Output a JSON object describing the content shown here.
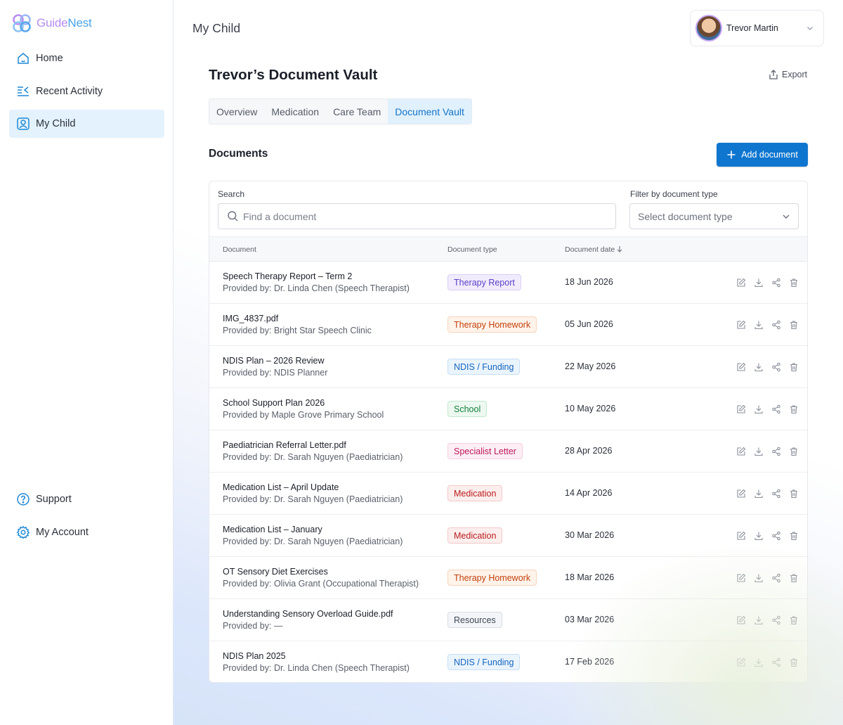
{
  "brand": {
    "name_part1": "Guide",
    "name_part2": "Nest"
  },
  "sidebar": {
    "top_items": [
      {
        "label": "Home",
        "icon": "home-icon",
        "active": false
      },
      {
        "label": "Recent Activity",
        "icon": "activity-icon",
        "active": false
      },
      {
        "label": "My Child",
        "icon": "child-profile-icon",
        "active": true
      }
    ],
    "bottom_items": [
      {
        "label": "Support",
        "icon": "help-icon"
      },
      {
        "label": "My Account",
        "icon": "gear-icon"
      }
    ]
  },
  "header": {
    "title": "My Child",
    "user_name": "Trevor Martin"
  },
  "vault": {
    "title": "Trevor’s Document Vault",
    "export_label": "Export"
  },
  "tabs": [
    {
      "label": "Overview",
      "active": false
    },
    {
      "label": "Medication",
      "active": false
    },
    {
      "label": "Care Team",
      "active": false
    },
    {
      "label": "Document Vault",
      "active": true
    }
  ],
  "documents": {
    "section_title": "Documents",
    "add_label": "Add document",
    "search_label": "Search",
    "search_placeholder": "Find a document",
    "filter_label": "Filter by document type",
    "filter_placeholder": "Select document type",
    "columns": {
      "document": "Document",
      "type": "Document type",
      "date": "Document date"
    },
    "rows": [
      {
        "name": "Speech Therapy Report – Term 2",
        "provider": "Provided by: Dr. Linda Chen (Speech Therapist)",
        "type": "Therapy Report",
        "date": "18 Jun 2026"
      },
      {
        "name": "IMG_4837.pdf",
        "provider": "Provided by: Bright Star Speech Clinic",
        "type": "Therapy Homework",
        "date": "05 Jun 2026"
      },
      {
        "name": "NDIS Plan – 2026 Review",
        "provider": "Provided by: NDIS Planner",
        "type": "NDIS / Funding",
        "date": "22 May 2026"
      },
      {
        "name": "School Support Plan 2026",
        "provider": "Provided by Maple Grove Primary School",
        "type": "School",
        "date": "10 May 2026"
      },
      {
        "name": "Paediatrician Referral Letter.pdf",
        "provider": "Provided by: Dr. Sarah Nguyen (Paediatrician)",
        "type": "Specialist Letter",
        "date": "28 Apr 2026"
      },
      {
        "name": "Medication List – April Update",
        "provider": "Provided by: Dr. Sarah Nguyen (Paediatrician)",
        "type": "Medication",
        "date": "14 Apr 2026"
      },
      {
        "name": "Medication List – January",
        "provider": "Provided by: Dr. Sarah Nguyen (Paediatrician)",
        "type": "Medication",
        "date": "30 Mar 2026"
      },
      {
        "name": "OT Sensory Diet Exercises",
        "provider": "Provided by: Olivia Grant (Occupational Therapist)",
        "type": "Therapy Homework",
        "date": "18 Mar 2026"
      },
      {
        "name": "Understanding Sensory Overload Guide.pdf",
        "provider": "Provided by: —",
        "type": "Resources",
        "date": "03 Mar 2026"
      },
      {
        "name": "NDIS Plan 2025",
        "provider": "Provided by: Dr. Linda Chen (Speech Therapist)",
        "type": "NDIS / Funding",
        "date": "17 Feb 2026"
      }
    ]
  },
  "badge_colors": {
    "Therapy Report": {
      "text": "#5b3fc4",
      "bg": "#f1ecfd",
      "border": "#d9cdf7"
    },
    "Therapy Homework": {
      "text": "#c2410c",
      "bg": "#fff3ea",
      "border": "#f7d3bd"
    },
    "NDIS / Funding": {
      "text": "#1565c0",
      "bg": "#eaf4fd",
      "border": "#c6def5"
    },
    "School": {
      "text": "#15803d",
      "bg": "#ecf8f0",
      "border": "#c4e8cf"
    },
    "Specialist Letter": {
      "text": "#be185d",
      "bg": "#fdeef5",
      "border": "#f5cce0"
    },
    "Medication": {
      "text": "#b91c1c",
      "bg": "#fdeeee",
      "border": "#f3c9c9"
    },
    "Resources": {
      "text": "#3f4756",
      "bg": "#f3f5f8",
      "border": "#d9dde4"
    }
  },
  "accent": "#0f76cf"
}
